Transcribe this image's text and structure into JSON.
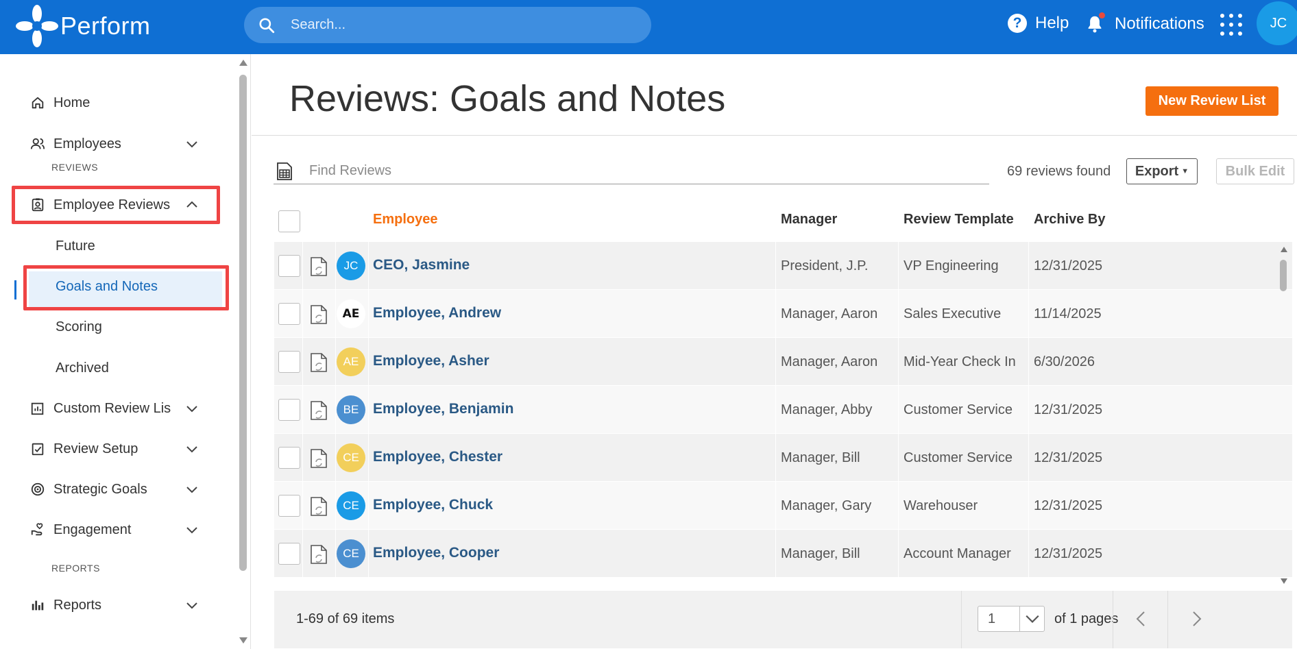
{
  "app": {
    "name": "Perform"
  },
  "search": {
    "placeholder": "Search..."
  },
  "header": {
    "help_label": "Help",
    "notifications_label": "Notifications",
    "user_initials": "JC"
  },
  "sidebar": {
    "home": "Home",
    "employees": "Employees",
    "reviews_section": "REVIEWS",
    "employee_reviews": "Employee Reviews",
    "future": "Future",
    "goals_and_notes": "Goals and Notes",
    "scoring": "Scoring",
    "archived": "Archived",
    "custom_review_lists": "Custom Review Lis",
    "review_setup": "Review Setup",
    "strategic_goals": "Strategic Goals",
    "engagement": "Engagement",
    "reports_section": "REPORTS",
    "reports": "Reports"
  },
  "main": {
    "title": "Reviews: Goals and Notes",
    "new_button": "New Review List",
    "find_placeholder": "Find Reviews",
    "found_text": "69 reviews found",
    "export_label": "Export",
    "bulk_edit_label": "Bulk Edit"
  },
  "table": {
    "columns": {
      "employee": "Employee",
      "manager": "Manager",
      "template": "Review Template",
      "archive": "Archive By"
    },
    "rows": [
      {
        "initials": "JC",
        "avatar_color": "#1a9be6",
        "employee": "CEO, Jasmine",
        "manager": "President, J.P.",
        "template": "VP Engineering",
        "archive": "12/31/2025"
      },
      {
        "initials": "AE",
        "avatar_color": "#ffffff",
        "employee": "Employee, Andrew",
        "manager": "Manager, Aaron",
        "template": "Sales Executive",
        "archive": "11/14/2025"
      },
      {
        "initials": "AE",
        "avatar_color": "#f2cf5b",
        "employee": "Employee, Asher",
        "manager": "Manager, Aaron",
        "template": "Mid-Year Check In",
        "archive": "6/30/2026"
      },
      {
        "initials": "BE",
        "avatar_color": "#4b8fd0",
        "employee": "Employee, Benjamin",
        "manager": "Manager, Abby",
        "template": "Customer Service",
        "archive": "12/31/2025"
      },
      {
        "initials": "CE",
        "avatar_color": "#f2cf5b",
        "employee": "Employee, Chester",
        "manager": "Manager, Bill",
        "template": "Customer Service",
        "archive": "12/31/2025"
      },
      {
        "initials": "CE",
        "avatar_color": "#1a9be6",
        "employee": "Employee, Chuck",
        "manager": "Manager, Gary",
        "template": "Warehouser",
        "archive": "12/31/2025"
      },
      {
        "initials": "CE",
        "avatar_color": "#4b8fd0",
        "employee": "Employee, Cooper",
        "manager": "Manager, Bill",
        "template": "Account Manager",
        "archive": "12/31/2025"
      }
    ]
  },
  "pager": {
    "items_text": "1-69 of 69 items",
    "page_value": "1",
    "of_pages": "of 1 pages"
  },
  "colors": {
    "brand": "#0f6fd3",
    "accent": "#f56f0f",
    "highlight": "#ef4444"
  }
}
